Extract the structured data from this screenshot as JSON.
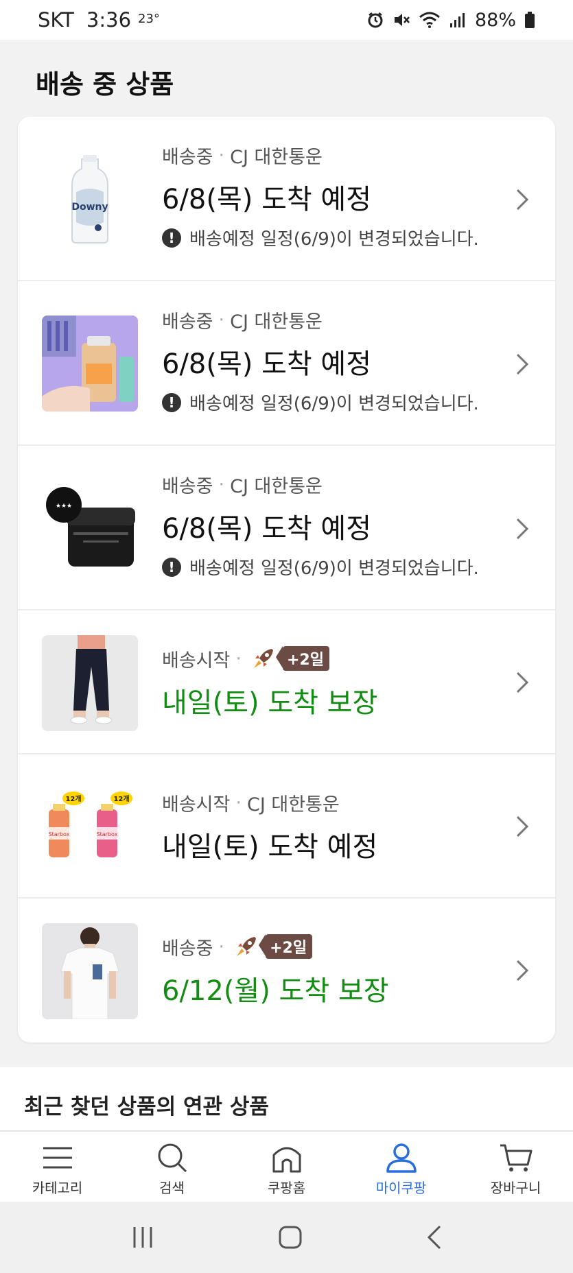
{
  "status_bar": {
    "carrier": "SKT",
    "time": "3:36",
    "temperature": "23°",
    "battery": "88%",
    "icons": [
      "alarm-icon",
      "mute-icon",
      "wifi-icon",
      "signal-icon",
      "battery-icon"
    ]
  },
  "page": {
    "title": "배송 중 상품"
  },
  "items": [
    {
      "status": "배송중",
      "carrier": "CJ 대한통운",
      "arrival": "6/8(목) 도착 예정",
      "arrival_color": "#111111",
      "notice": "배송예정 일정(6/9)이 변경되었습니다.",
      "product": "downy-bottle"
    },
    {
      "status": "배송중",
      "carrier": "CJ 대한통운",
      "arrival": "6/8(목) 도착 예정",
      "arrival_color": "#111111",
      "notice": "배송예정 일정(6/9)이 변경되었습니다.",
      "product": "shampoo-bottle"
    },
    {
      "status": "배송중",
      "carrier": "CJ 대한통운",
      "arrival": "6/8(목) 도착 예정",
      "arrival_color": "#111111",
      "notice": "배송예정 일정(6/9)이 변경되었습니다.",
      "product": "hair-wax-jar"
    },
    {
      "status": "배송시작",
      "badge": "+2일",
      "arrival": "내일(토) 도착 보장",
      "arrival_color": "#128c12",
      "product": "black-pants"
    },
    {
      "status": "배송시작",
      "carrier": "CJ 대한통운",
      "arrival": "내일(토) 도착 예정",
      "arrival_color": "#111111",
      "product": "drink-bottles",
      "product_tags": [
        "12개",
        "12개"
      ],
      "product_labels": [
        "Starbox",
        "Starbox"
      ]
    },
    {
      "status": "배송중",
      "badge": "+2일",
      "arrival": "6/12(월) 도착 보장",
      "arrival_color": "#128c12",
      "product": "white-tshirt"
    }
  ],
  "related": {
    "title": "최근 찾던 상품의 연관 상품"
  },
  "bottom_nav": [
    {
      "label": "카테고리",
      "icon": "menu-icon",
      "active": false
    },
    {
      "label": "검색",
      "icon": "search-icon",
      "active": false
    },
    {
      "label": "쿠팡홈",
      "icon": "home-icon",
      "active": false
    },
    {
      "label": "마이쿠팡",
      "icon": "person-icon",
      "active": true
    },
    {
      "label": "장바구니",
      "icon": "cart-icon",
      "active": false
    }
  ],
  "colors": {
    "accent": "#2a6edb",
    "guarantee_green": "#128c12",
    "badge_brown": "#6b4b44"
  }
}
